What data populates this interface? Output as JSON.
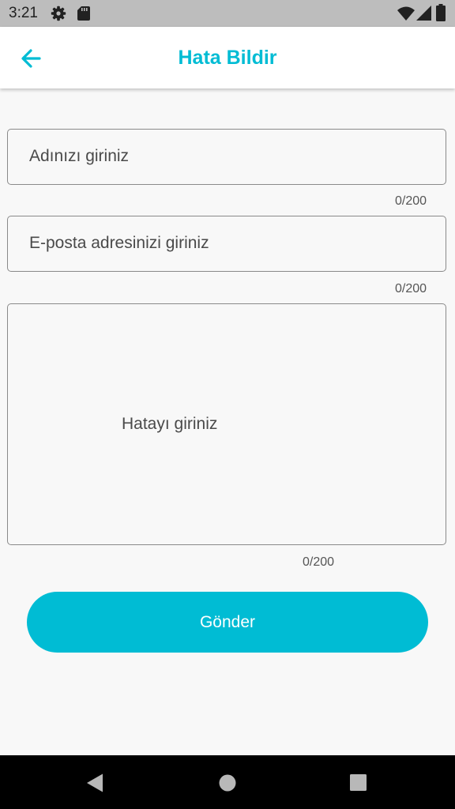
{
  "status_bar": {
    "time": "3:21",
    "icons": [
      "gear-icon",
      "sd-card-icon",
      "wifi-icon",
      "signal-icon",
      "battery-icon"
    ]
  },
  "app_bar": {
    "back_icon": "arrow-left-icon",
    "title": "Hata Bildir"
  },
  "form": {
    "name_field": {
      "placeholder": "Adınızı giriniz",
      "counter": "0/200"
    },
    "email_field": {
      "placeholder": "E-posta adresinizi giriniz",
      "counter": "0/200"
    },
    "error_field": {
      "placeholder": "Hatayı giriniz",
      "counter": "0/200"
    },
    "submit_label": "Gönder"
  },
  "nav_bar": {
    "icons": [
      "nav-back-icon",
      "nav-home-icon",
      "nav-recents-icon"
    ]
  },
  "colors": {
    "accent": "#00bcd4",
    "status_bar": "#bdbdbd",
    "background": "#f8f8f8",
    "field_border": "#8a8a8a",
    "nav_bar": "#000000"
  }
}
